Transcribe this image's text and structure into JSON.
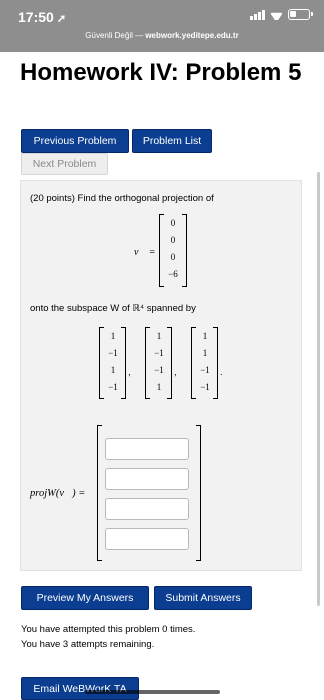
{
  "status": {
    "time": "17:50",
    "location_arrow": "➚"
  },
  "url_bar": {
    "security": "Güvenli Değil",
    "separator": " — ",
    "host": "webwork.yeditepe.edu.tr"
  },
  "page_title": "Homework IV: Problem 5",
  "nav": {
    "previous_label": "Previous Problem",
    "list_label": "Problem List",
    "next_label": "Next Problem"
  },
  "problem": {
    "intro": "(20 points) Find the orthogonal projection of",
    "vector_label": "v⃗ =",
    "vector": [
      "0",
      "0",
      "0",
      "−6"
    ],
    "onto_text": "onto the subspace W of ℝ⁴ spanned by",
    "spanning_vectors": [
      [
        "1",
        "−1",
        "1",
        "−1"
      ],
      [
        "1",
        "−1",
        "−1",
        "1"
      ],
      [
        "1",
        "1",
        "−1",
        "−1"
      ]
    ],
    "proj_label": "projW(v⃗) ="
  },
  "answers": [
    "",
    "",
    "",
    ""
  ],
  "actions": {
    "preview_label": "Preview My Answers",
    "submit_label": "Submit Answers"
  },
  "attempts": {
    "line1": "You have attempted this problem 0 times.",
    "line2": "You have 3 attempts remaining."
  },
  "email_label": "Email WeBWorK TA"
}
